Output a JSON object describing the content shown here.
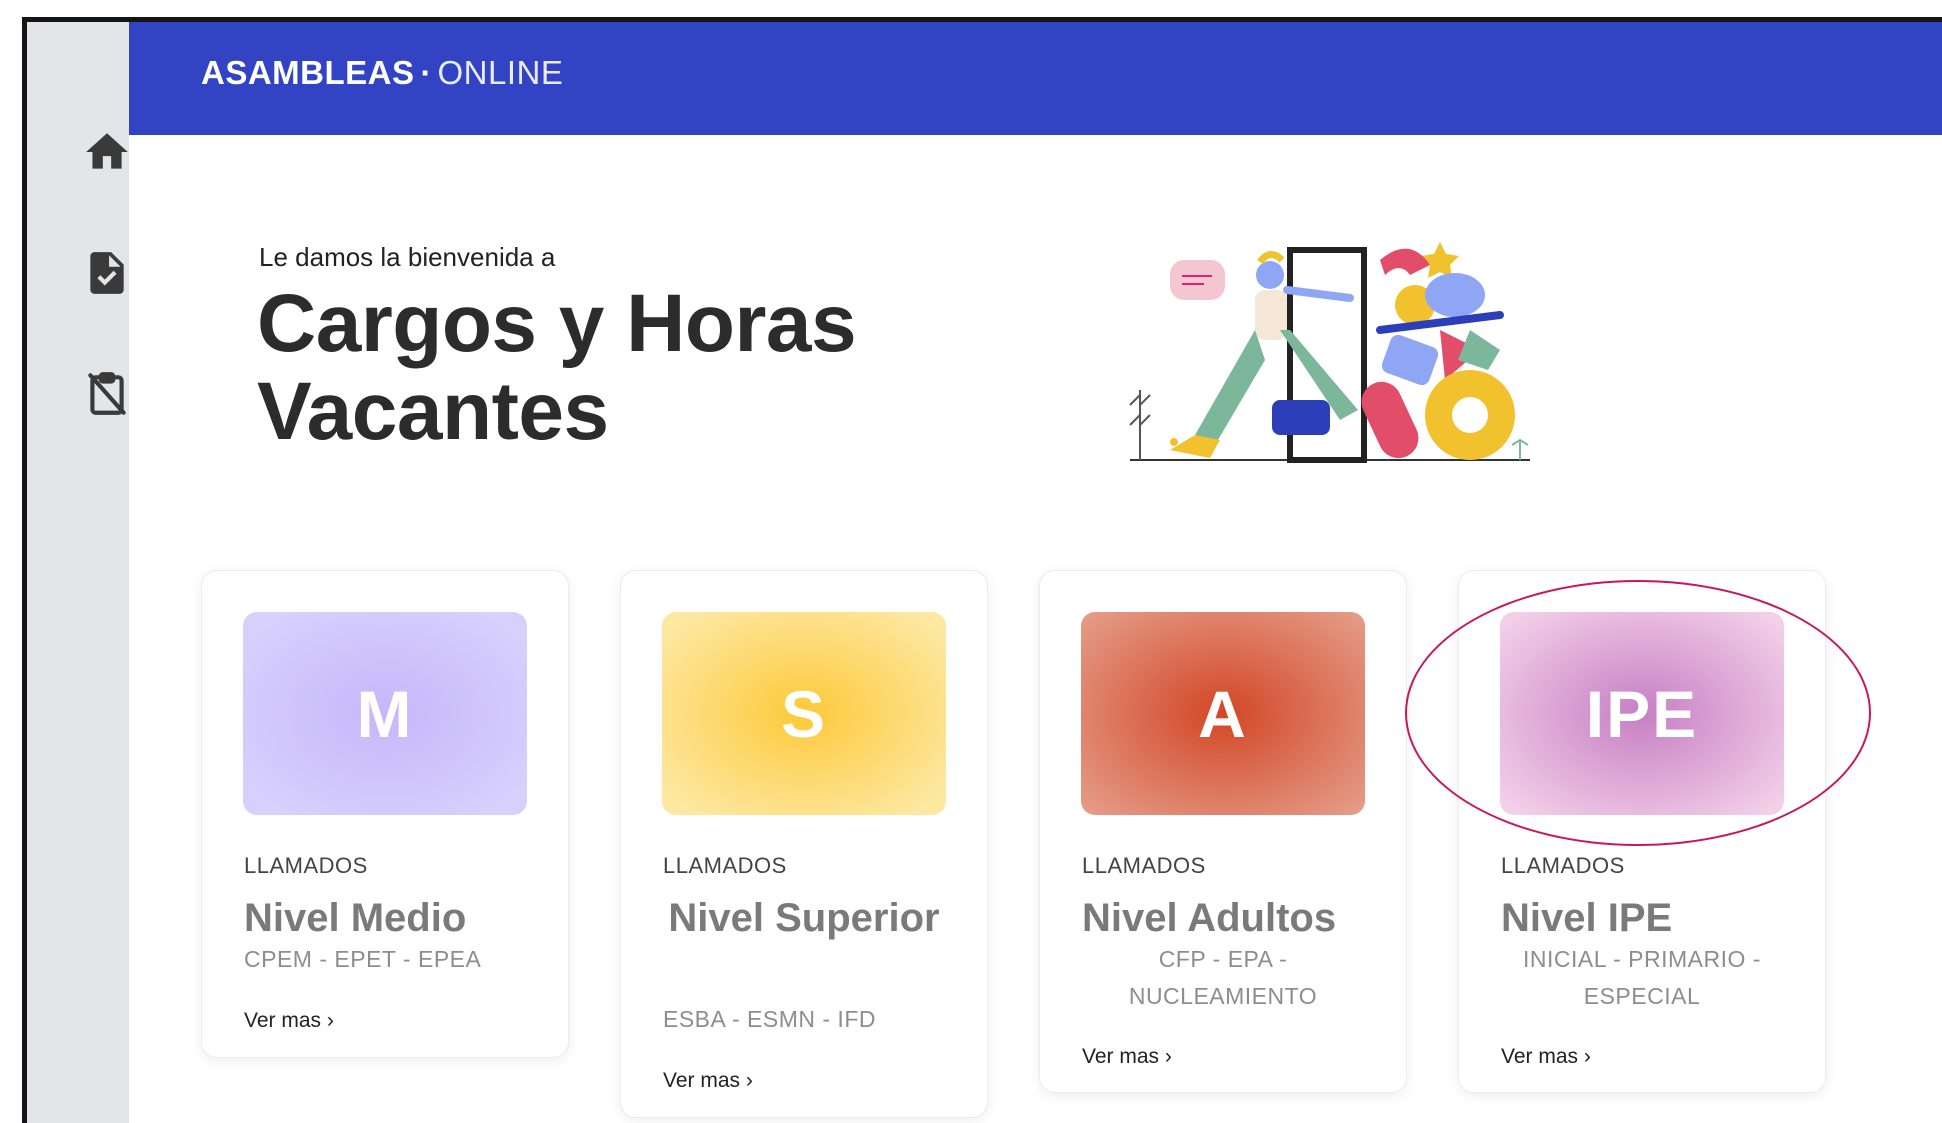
{
  "app": {
    "brand_main": "ASAMBLEAS",
    "brand_sep": "·",
    "brand_sub": "ONLINE",
    "primary_color": "#3244c4"
  },
  "sidebar": {
    "items": [
      {
        "icon": "home-icon"
      },
      {
        "icon": "document-check-icon"
      },
      {
        "icon": "clipboard-off-icon"
      }
    ]
  },
  "hero": {
    "welcome": "Le damos la bienvenida a",
    "title": "Cargos y Horas Vacantes"
  },
  "cards": [
    {
      "letter": "M",
      "eyebrow": "LLAMADOS",
      "title": "Nivel Medio",
      "subtitle": "CPEM - EPET - EPEA",
      "link": "Ver mas ›",
      "color": "#c9bffb"
    },
    {
      "letter": "S",
      "eyebrow": "LLAMADOS",
      "title": "Nivel Superior",
      "subtitle": "ESBA - ESMN - IFD",
      "link": "Ver mas ›",
      "color": "#fdd13c"
    },
    {
      "letter": "A",
      "eyebrow": "LLAMADOS",
      "title": "Nivel Adultos",
      "subtitle": "CFP - EPA - NUCLEAMIENTO",
      "link": "Ver mas ›",
      "color": "#d9553a"
    },
    {
      "letter": "IPE",
      "eyebrow": "LLAMADOS",
      "title": "Nivel IPE",
      "subtitle": "INICIAL - PRIMARIO - ESPECIAL",
      "link": "Ver mas ›",
      "color": "#c67fc4"
    }
  ]
}
